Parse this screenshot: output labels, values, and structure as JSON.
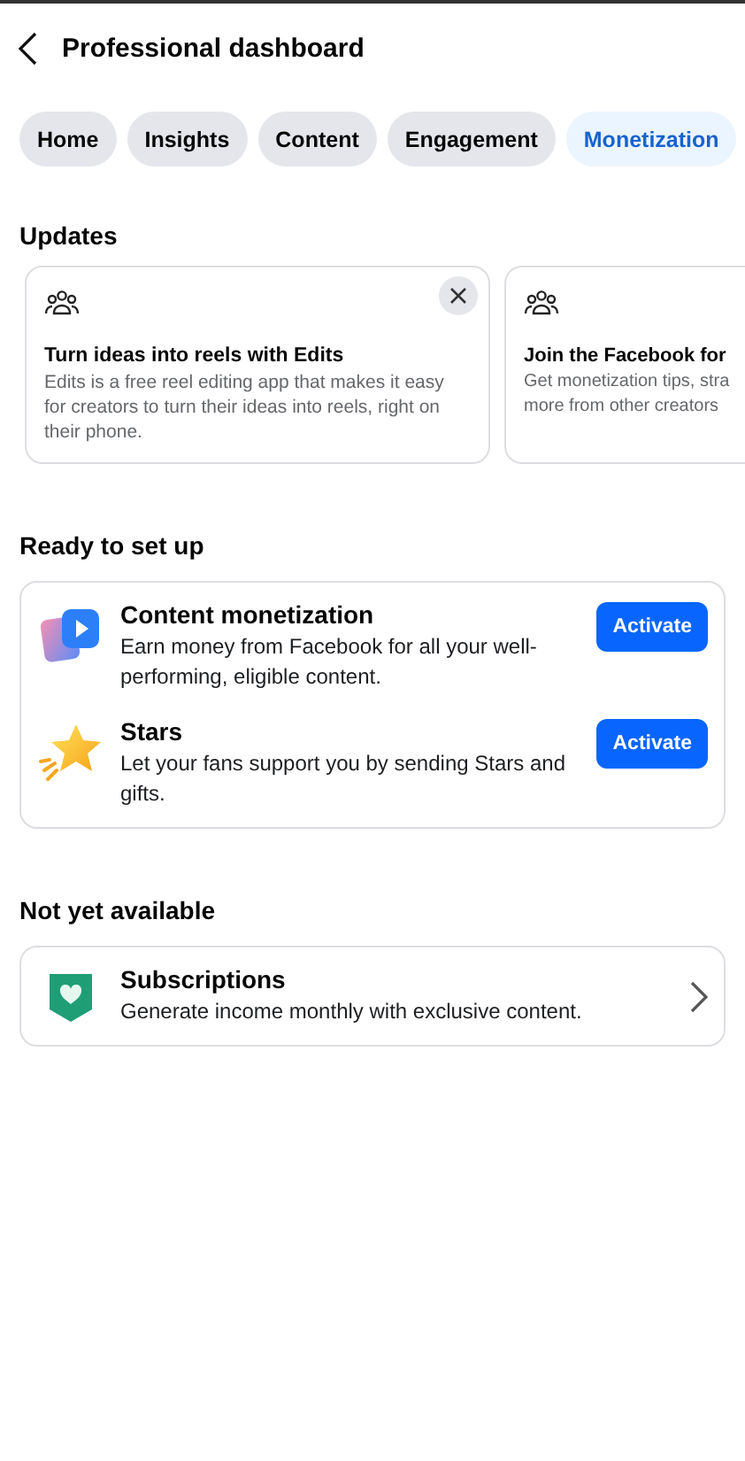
{
  "header": {
    "title": "Professional dashboard"
  },
  "tabs": [
    {
      "label": "Home",
      "selected": false
    },
    {
      "label": "Insights",
      "selected": false
    },
    {
      "label": "Content",
      "selected": false
    },
    {
      "label": "Engagement",
      "selected": false
    },
    {
      "label": "Monetization",
      "selected": true
    }
  ],
  "updates": {
    "heading": "Updates",
    "cards": [
      {
        "title": "Turn ideas into reels with Edits",
        "body": "Edits is a free reel editing app that makes it easy for creators to turn their ideas into reels, right on their phone.",
        "dismissible": true
      },
      {
        "title": "Join the Facebook for",
        "body_lines": [
          "Get monetization tips, stra",
          "more from other creators"
        ],
        "dismissible": false
      }
    ]
  },
  "ready": {
    "heading": "Ready to set up",
    "items": [
      {
        "title": "Content monetization",
        "body": "Earn money from Facebook for all your well-performing, eligible content.",
        "button": "Activate"
      },
      {
        "title": "Stars",
        "body": "Let your fans support you by sending Stars and gifts.",
        "button": "Activate"
      }
    ]
  },
  "not_yet": {
    "heading": "Not yet available",
    "items": [
      {
        "title": "Subscriptions",
        "body": "Generate income monthly with exclusive content."
      }
    ]
  }
}
